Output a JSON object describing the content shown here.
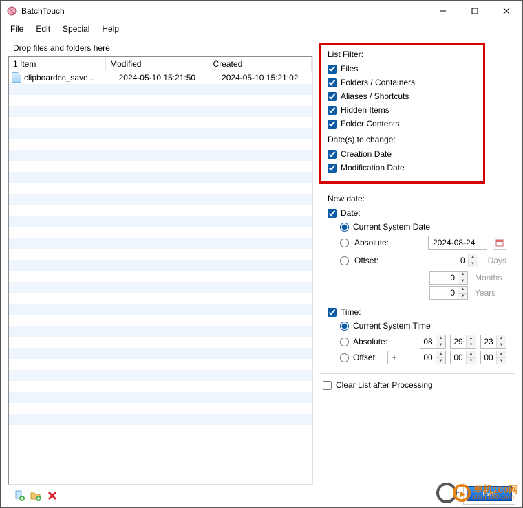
{
  "window": {
    "title": "BatchTouch",
    "buttons": {
      "min": "Minimize",
      "max": "Maximize",
      "close": "Close"
    }
  },
  "menu": [
    "File",
    "Edit",
    "Special",
    "Help"
  ],
  "drop_label": "Drop files and folders here:",
  "table": {
    "header_count": "1 Item",
    "cols": [
      "Modified",
      "Created"
    ],
    "rows": [
      {
        "name": "clipboardcc_save...",
        "modified": "2024-05-10 15:21:50",
        "created": "2024-05-10 15:21:02"
      }
    ]
  },
  "toolbar": {
    "add_file": "Add file",
    "add_folder": "Add folder",
    "remove": "Remove"
  },
  "list_filter": {
    "title": "List Filter:",
    "files": "Files",
    "folders": "Folders / Containers",
    "aliases": "Aliases / Shortcuts",
    "hidden": "Hidden Items",
    "contents": "Folder Contents"
  },
  "dates_to_change": {
    "title": "Date(s) to change:",
    "creation": "Creation Date",
    "modification": "Modification Date"
  },
  "new_date": {
    "title": "New date:",
    "date_label": "Date:",
    "current_date": "Current System Date",
    "absolute": "Absolute:",
    "absolute_value": "2024-08-24",
    "offset": "Offset:",
    "offset_days": "0",
    "offset_days_suffix": "Days",
    "offset_months": "0",
    "offset_months_suffix": "Months",
    "offset_years": "0",
    "offset_years_suffix": "Years",
    "time_label": "Time:",
    "current_time": "Current System Time",
    "time_abs": "Absolute:",
    "time_h": "08",
    "time_m": "29",
    "time_s": "23",
    "time_offset": "Offset:",
    "time_op": "+",
    "toff_h": "00",
    "toff_m": "00",
    "toff_s": "00"
  },
  "clear_list": "Clear List after Processing",
  "go": "Go!",
  "watermark": {
    "brand": "单机100",
    "suffix": "网",
    "domain": "danji100.com"
  }
}
